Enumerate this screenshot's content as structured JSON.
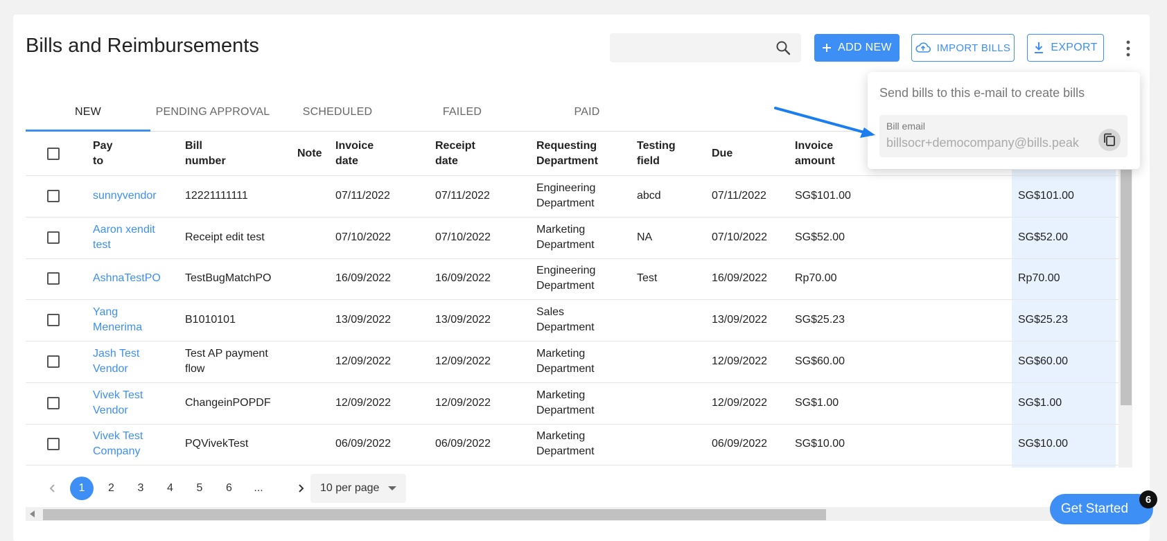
{
  "page": {
    "title": "Bills and Reimbursements"
  },
  "search": {
    "placeholder": "",
    "icon": "search-icon"
  },
  "toolbar": {
    "add_new_label": "ADD NEW",
    "import_label": "IMPORT BILLS",
    "export_label": "EXPORT",
    "accent": "#3d8ff5"
  },
  "tabs": [
    {
      "label": "NEW",
      "active": true
    },
    {
      "label": "PENDING APPROVAL",
      "active": false
    },
    {
      "label": "SCHEDULED",
      "active": false
    },
    {
      "label": "FAILED",
      "active": false
    },
    {
      "label": "PAID",
      "active": false
    }
  ],
  "table": {
    "headers": {
      "pay_to": [
        "Pay",
        "to"
      ],
      "bill_number": [
        "Bill",
        "number"
      ],
      "note": "Note",
      "invoice_date": [
        "Invoice",
        "date"
      ],
      "receipt_date": [
        "Receipt",
        "date"
      ],
      "requesting_department": [
        "Requesting",
        "Department"
      ],
      "testing_field": [
        "Testing",
        "field"
      ],
      "due": "Due",
      "invoice_amount": [
        "Invoice",
        "amount"
      ]
    },
    "rows": [
      {
        "pay_to": [
          "sunnyvendor"
        ],
        "bill_number": [
          "12221111111"
        ],
        "note": "",
        "invoice_date": "07/11/2022",
        "receipt_date": "07/11/2022",
        "department": [
          "Engineering",
          "Department"
        ],
        "testing_field": "abcd",
        "due": "07/11/2022",
        "invoice_amount": "SG$101.00",
        "amount": "SG$101.00"
      },
      {
        "pay_to": [
          "Aaron xendit",
          "test"
        ],
        "bill_number": [
          "Receipt edit test"
        ],
        "note": "",
        "invoice_date": "07/10/2022",
        "receipt_date": "07/10/2022",
        "department": [
          "Marketing",
          "Department"
        ],
        "testing_field": "NA",
        "due": "07/10/2022",
        "invoice_amount": "SG$52.00",
        "amount": "SG$52.00"
      },
      {
        "pay_to": [
          "AshnaTestPO"
        ],
        "bill_number": [
          "TestBugMatchPO"
        ],
        "note": "",
        "invoice_date": "16/09/2022",
        "receipt_date": "16/09/2022",
        "department": [
          "Engineering",
          "Department"
        ],
        "testing_field": "Test",
        "due": "16/09/2022",
        "invoice_amount": "Rp70.00",
        "amount": "Rp70.00"
      },
      {
        "pay_to": [
          "Yang",
          "Menerima"
        ],
        "bill_number": [
          "B1010101"
        ],
        "note": "",
        "invoice_date": "13/09/2022",
        "receipt_date": "13/09/2022",
        "department": [
          "Sales",
          "Department"
        ],
        "testing_field": "",
        "due": "13/09/2022",
        "invoice_amount": "SG$25.23",
        "amount": "SG$25.23"
      },
      {
        "pay_to": [
          "Jash Test",
          "Vendor"
        ],
        "bill_number": [
          "Test AP payment",
          "flow"
        ],
        "note": "",
        "invoice_date": "12/09/2022",
        "receipt_date": "12/09/2022",
        "department": [
          "Marketing",
          "Department"
        ],
        "testing_field": "",
        "due": "12/09/2022",
        "invoice_amount": "SG$60.00",
        "amount": "SG$60.00"
      },
      {
        "pay_to": [
          "Vivek Test",
          "Vendor"
        ],
        "bill_number": [
          "ChangeinPOPDF"
        ],
        "note": "",
        "invoice_date": "12/09/2022",
        "receipt_date": "12/09/2022",
        "department": [
          "Marketing",
          "Department"
        ],
        "testing_field": "",
        "due": "12/09/2022",
        "invoice_amount": "SG$1.00",
        "amount": "SG$1.00"
      },
      {
        "pay_to": [
          "Vivek Test",
          "Company"
        ],
        "bill_number": [
          "PQVivekTest"
        ],
        "note": "",
        "invoice_date": "06/09/2022",
        "receipt_date": "06/09/2022",
        "department": [
          "Marketing",
          "Department"
        ],
        "testing_field": "",
        "due": "06/09/2022",
        "invoice_amount": "SG$10.00",
        "amount": "SG$10.00"
      }
    ]
  },
  "pagination": {
    "pages": [
      "1",
      "2",
      "3",
      "4",
      "5",
      "6",
      "..."
    ],
    "current": "1",
    "per_page": "10 per page"
  },
  "popover": {
    "heading": "Send bills to this e-mail to create bills",
    "email_label": "Bill email",
    "email_value": "billsocr+democompany@bills.peak"
  },
  "get_started": {
    "label": "Get Started",
    "badge": "6"
  }
}
